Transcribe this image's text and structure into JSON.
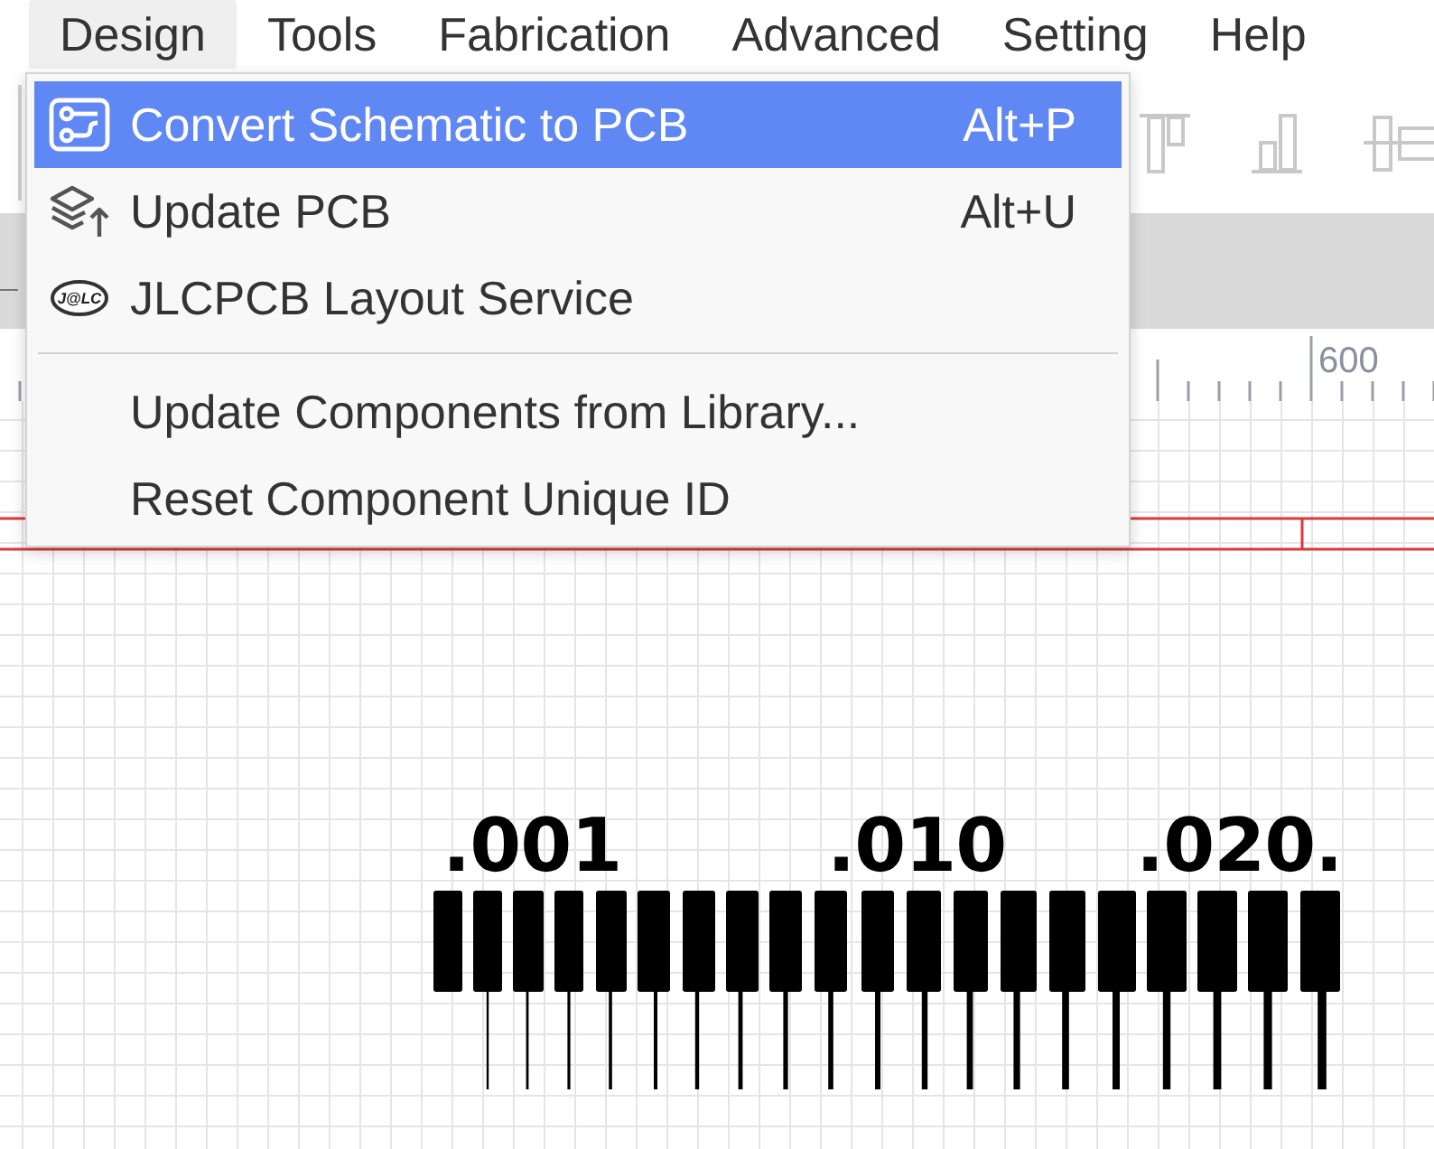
{
  "menubar": [
    {
      "label": "Design",
      "selected": true
    },
    {
      "label": "Tools",
      "selected": false
    },
    {
      "label": "Fabrication",
      "selected": false
    },
    {
      "label": "Advanced",
      "selected": false
    },
    {
      "label": "Setting",
      "selected": false
    },
    {
      "label": "Help",
      "selected": false
    }
  ],
  "menu": {
    "sections": [
      [
        {
          "kind": "convert",
          "label": "Convert Schematic to PCB",
          "shortcut": "Alt+P",
          "selected": true
        },
        {
          "kind": "update",
          "label": "Update PCB",
          "shortcut": "Alt+U",
          "selected": false
        },
        {
          "kind": "service",
          "label": "JLCPCB Layout Service",
          "logo_text": "J@LC",
          "selected": false
        }
      ],
      [
        {
          "kind": "plain",
          "label": "Update Components from Library...",
          "selected": false
        },
        {
          "kind": "plain",
          "label": "Reset Component Unique ID",
          "selected": false
        }
      ]
    ]
  },
  "ruler": {
    "labels": [
      "600"
    ]
  },
  "canvas": {
    "labels": [
      ".001",
      ".010",
      ".020."
    ]
  }
}
